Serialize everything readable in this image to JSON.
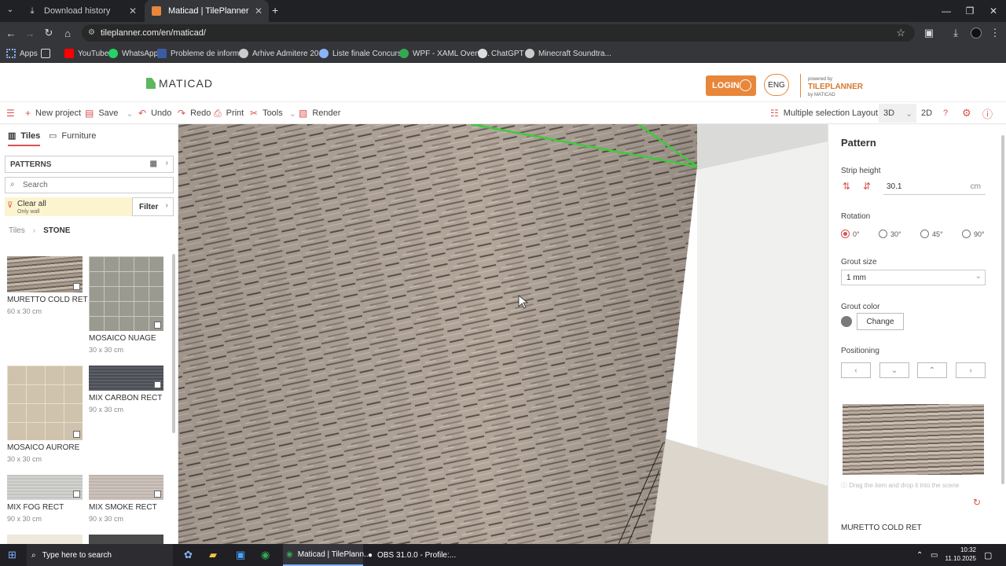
{
  "browser": {
    "tabs": [
      {
        "label": "Download history"
      },
      {
        "label": "Maticad | TilePlanner"
      }
    ],
    "url": "tileplanner.com/en/maticad/",
    "bookmarks": [
      {
        "label": "Apps",
        "color": "#4285f4"
      },
      {
        "label": "YouTube",
        "color": "#ff0000"
      },
      {
        "label": "WhatsApp",
        "color": "#25d366"
      },
      {
        "label": "Probleme de inform...",
        "color": "#3b5ba5"
      },
      {
        "label": "Arhive Admitere 20...",
        "color": "#cccccc"
      },
      {
        "label": "Liste finale Concurs...",
        "color": "#8ab4f8"
      },
      {
        "label": "WPF - XAML Overvi...",
        "color": "#34a853"
      },
      {
        "label": "ChatGPT",
        "color": "#dddddd"
      },
      {
        "label": "Minecraft Soundtra...",
        "color": "#cccccc"
      }
    ]
  },
  "header": {
    "logo": "MATICAD",
    "login": "LOGIN",
    "lang": "ENG",
    "tp_small": "powered by",
    "tp_brand": "TILEPLANNER",
    "tp_by": "by MATICAD"
  },
  "toolbar": {
    "new_project": "New project",
    "save": "Save",
    "undo": "Undo",
    "redo": "Redo",
    "print": "Print",
    "tools": "Tools",
    "render": "Render",
    "multiple_selection": "Multiple selection",
    "layout": "Layout",
    "view3d": "3D",
    "view2d": "2D",
    "help": "?"
  },
  "sidebar": {
    "tab_tiles": "Tiles",
    "tab_furniture": "Furniture",
    "patterns": "PATTERNS",
    "search_placeholder": "Search",
    "clear_all": "Clear all",
    "only_wall": "Only wall",
    "filter": "Filter",
    "crumb_root": "Tiles",
    "crumb_current": "STONE",
    "tiles": [
      {
        "name": "MURETTO COLD RET",
        "size": "60 x 30 cm"
      },
      {
        "name": "MOSAICO NUAGE",
        "size": "30 x 30 cm"
      },
      {
        "name": "MOSAICO AURORE",
        "size": "30 x 30 cm"
      },
      {
        "name": "MIX CARBON RECT",
        "size": "90 x 30 cm"
      },
      {
        "name": "MIX FOG RECT",
        "size": "90 x 30 cm"
      },
      {
        "name": "MIX SMOKE RECT",
        "size": "90 x 30 cm"
      }
    ]
  },
  "panel": {
    "title": "Pattern",
    "strip_height_label": "Strip height",
    "strip_height_value": "30.1",
    "strip_height_unit": "cm",
    "rotation_label": "Rotation",
    "rotations": [
      "0°",
      "30°",
      "45°",
      "90°"
    ],
    "rotation_selected": "0°",
    "grout_size_label": "Grout size",
    "grout_size_value": "1 mm",
    "grout_color_label": "Grout color",
    "grout_color": "#7a7a7a",
    "change": "Change",
    "positioning_label": "Positioning",
    "drag_hint": "Drag the item and drop it into the scene",
    "selected_tile": "MURETTO COLD RET"
  },
  "taskbar": {
    "search_placeholder": "Type here to search",
    "app1": "Maticad | TilePlann...",
    "app2": "OBS 31.0.0 - Profile:...",
    "time": "10:32",
    "date": "11.10.2025"
  },
  "colors": {
    "accent": "#e8863a",
    "red_icon": "#d9534f",
    "logo_green": "#5cb85c"
  }
}
